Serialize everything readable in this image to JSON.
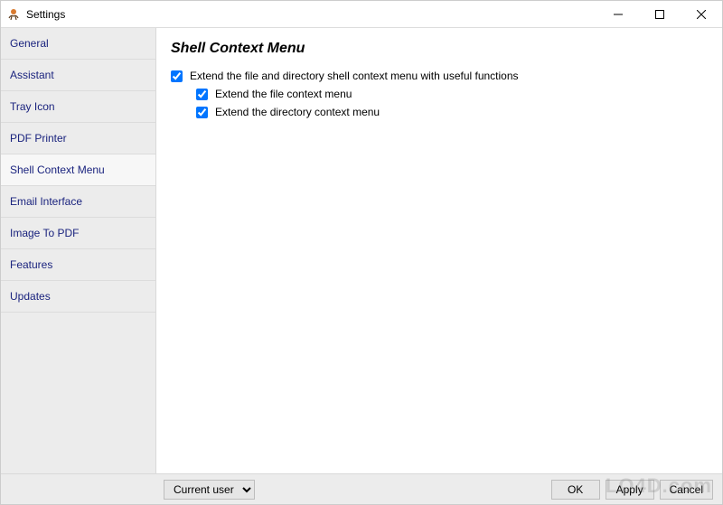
{
  "window": {
    "title": "Settings"
  },
  "sidebar": {
    "items": [
      {
        "label": "General"
      },
      {
        "label": "Assistant"
      },
      {
        "label": "Tray Icon"
      },
      {
        "label": "PDF Printer"
      },
      {
        "label": "Shell Context Menu"
      },
      {
        "label": "Email Interface"
      },
      {
        "label": "Image To PDF"
      },
      {
        "label": "Features"
      },
      {
        "label": "Updates"
      }
    ],
    "selected_index": 4
  },
  "content": {
    "heading": "Shell Context Menu",
    "main_option": {
      "label": "Extend the file and directory shell context menu with useful functions",
      "checked": true
    },
    "sub_options": [
      {
        "label": "Extend the file context menu",
        "checked": true
      },
      {
        "label": "Extend the directory context menu",
        "checked": true
      }
    ]
  },
  "footer": {
    "scope_selected": "Current user",
    "buttons": {
      "ok": "OK",
      "apply": "Apply",
      "cancel": "Cancel"
    }
  },
  "watermark": "LO4D.com"
}
